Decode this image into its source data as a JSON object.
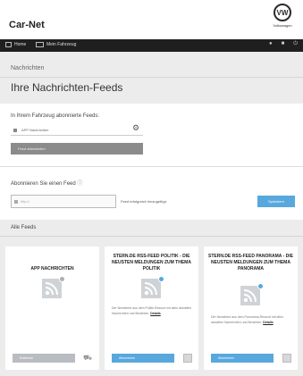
{
  "app": {
    "title": "Car-Net",
    "brand_name": "Volkswagen"
  },
  "navbar": {
    "items": [
      {
        "label": "Home",
        "icon": "grid-icon"
      },
      {
        "label": "Mein Fahrzeug",
        "icon": "car-icon"
      }
    ],
    "right_icons": [
      "user-icon",
      "lock-icon",
      "power-icon"
    ]
  },
  "subheader": {
    "breadcrumb": "Nachrichten",
    "title": "Ihre Nachrichten-Feeds"
  },
  "subscribed": {
    "heading": "In Ihrem Fahrzeug abonnierte Feeds:",
    "feeds": [
      {
        "label": "APP Nachrichten"
      }
    ],
    "unsubscribe_label": "Feed abbestellen"
  },
  "add_feed": {
    "heading": "Abonnieren Sie einen Feed",
    "input_placeholder": "http://",
    "status_text": "Feed erfolgreich hinzugefügt.",
    "save_label": "Speichern"
  },
  "all_feeds": {
    "heading": "Alle Feeds",
    "cards": [
      {
        "title": "APP NACHRICHTEN",
        "description": "",
        "link": "",
        "button_label": "Entfernen",
        "button_style": "grey",
        "extra_icon": "car-icon"
      },
      {
        "title": "STERN.DE RSS-FEED POLITIK - DIE NEUSTEN MELDUNGEN ZUM THEMA POLITIK",
        "description": "Der Newsfeed aus dem Politik-Ressort mit allen aktuellen Nachrichten und Berichten.",
        "link": "Details",
        "button_label": "Abonnieren",
        "button_style": "blue",
        "extra_icon": "trash-icon"
      },
      {
        "title": "STERN.DE RSS-FEED PANORAMA - DIE NEUSTEN MELDUNGEN ZUM THEMA PANORAMA",
        "description": "Der Newsfeed aus dem Panorama-Ressort mit allen aktuellen Nachrichten und Berichten.",
        "link": "Details",
        "button_label": "Abonnieren",
        "button_style": "blue",
        "extra_icon": "trash-icon"
      }
    ]
  },
  "colors": {
    "accent": "#58a8de",
    "navbar": "#1f1f1f",
    "band": "#ececec"
  }
}
